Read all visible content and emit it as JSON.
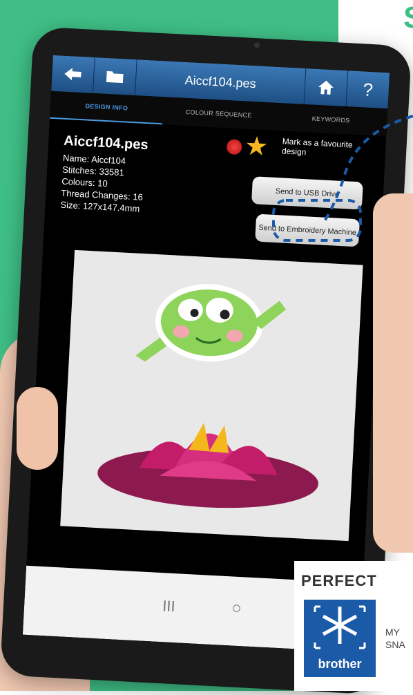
{
  "colors": {
    "brand_green": "#3fbf86",
    "accent_blue": "#1b5aa6"
  },
  "corner_text": "S",
  "topbar": {
    "back_icon": "arrow-left-icon",
    "folder_icon": "folder-icon",
    "title": "Aiccf104.pes",
    "home_icon": "home-icon",
    "help_label": "?"
  },
  "tabs": [
    {
      "label": "DESIGN INFO"
    },
    {
      "label": "COLOUR SEQUENCE"
    },
    {
      "label": "KEYWORDS"
    }
  ],
  "design_info": {
    "filename": "Aiccf104.pes",
    "name": "Name: Aiccf104",
    "stitches": "Stitches: 33581",
    "colours": "Colours: 10",
    "thread_changes": "Thread Changes: 16",
    "size": "Size: 127x147.4mm"
  },
  "favourite": {
    "label": "Mark as a favourite design"
  },
  "buttons": {
    "usb": "Send to USB Drive",
    "embroidery": "Send to Embroidery Machine"
  },
  "android_nav": {
    "recents": "III",
    "home": "○"
  },
  "promo": {
    "headline": "PERFECT",
    "logo_text": "brother",
    "line1": "MY",
    "line2": "SNA"
  }
}
